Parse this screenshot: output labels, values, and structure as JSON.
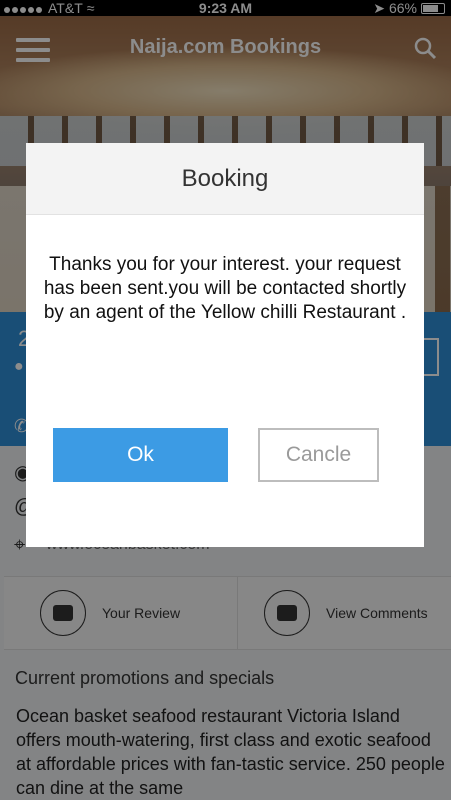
{
  "status_bar": {
    "carrier": "AT&T",
    "time": "9:23 AM",
    "battery": "66%",
    "battery_level": 0.66
  },
  "app_bar": {
    "title": "Naija.com Bookings",
    "menu_icon": "hamburger-icon",
    "search_icon": "search-icon"
  },
  "contact": {
    "website": "www.oceanbasket.com"
  },
  "actions": {
    "review_label": "Your Review",
    "comments_label": "View Comments"
  },
  "promotions": {
    "heading": "Current promotions and specials",
    "text": "Ocean basket seafood restaurant Victoria Island offers mouth-watering, first class and exotic seafood at affordable prices with fan-tastic service. 250 people can dine at the same"
  },
  "dialog": {
    "title": "Booking",
    "message": "Thanks you for your interest. your request has been sent.you will be contacted shortly by an agent of the Yellow chilli Restaurant .",
    "ok_label": "Ok",
    "cancel_label": "Cancle"
  },
  "colors": {
    "accent": "#3c9be4",
    "info_band": "#2f8fd8"
  }
}
